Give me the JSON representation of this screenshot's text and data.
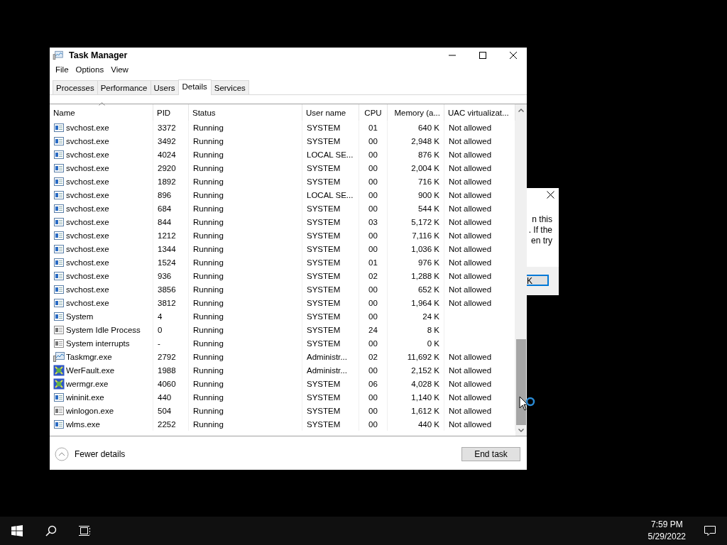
{
  "window": {
    "title": "Task Manager"
  },
  "menu": [
    "File",
    "Options",
    "View"
  ],
  "tabs": [
    {
      "label": "Processes",
      "selected": false
    },
    {
      "label": "Performance",
      "selected": false
    },
    {
      "label": "Users",
      "selected": false
    },
    {
      "label": "Details",
      "selected": true
    },
    {
      "label": "Services",
      "selected": false
    }
  ],
  "table": {
    "columns": [
      {
        "label": "Name",
        "sorted": true
      },
      {
        "label": "PID",
        "sorted": false
      },
      {
        "label": "Status",
        "sorted": false
      },
      {
        "label": "User name",
        "sorted": false
      },
      {
        "label": "CPU",
        "sorted": false
      },
      {
        "label": "Memory (a...",
        "sorted": false
      },
      {
        "label": "UAC virtualizat...",
        "sorted": false
      }
    ],
    "rows": [
      {
        "kind": "service",
        "cells": [
          "svchost.exe",
          "3372",
          "Running",
          "SYSTEM",
          "01",
          "640 K",
          "Not allowed"
        ]
      },
      {
        "kind": "service",
        "cells": [
          "svchost.exe",
          "3492",
          "Running",
          "SYSTEM",
          "00",
          "2,948 K",
          "Not allowed"
        ]
      },
      {
        "kind": "service",
        "cells": [
          "svchost.exe",
          "4024",
          "Running",
          "LOCAL SE...",
          "00",
          "876 K",
          "Not allowed"
        ]
      },
      {
        "kind": "service",
        "cells": [
          "svchost.exe",
          "2920",
          "Running",
          "SYSTEM",
          "00",
          "2,004 K",
          "Not allowed"
        ]
      },
      {
        "kind": "service",
        "cells": [
          "svchost.exe",
          "1892",
          "Running",
          "SYSTEM",
          "00",
          "716 K",
          "Not allowed"
        ]
      },
      {
        "kind": "service",
        "cells": [
          "svchost.exe",
          "896",
          "Running",
          "LOCAL SE...",
          "00",
          "900 K",
          "Not allowed"
        ]
      },
      {
        "kind": "service",
        "cells": [
          "svchost.exe",
          "684",
          "Running",
          "SYSTEM",
          "00",
          "544 K",
          "Not allowed"
        ]
      },
      {
        "kind": "service",
        "cells": [
          "svchost.exe",
          "844",
          "Running",
          "SYSTEM",
          "03",
          "5,172 K",
          "Not allowed"
        ]
      },
      {
        "kind": "service",
        "cells": [
          "svchost.exe",
          "1212",
          "Running",
          "SYSTEM",
          "00",
          "7,116 K",
          "Not allowed"
        ]
      },
      {
        "kind": "service",
        "cells": [
          "svchost.exe",
          "1344",
          "Running",
          "SYSTEM",
          "00",
          "1,036 K",
          "Not allowed"
        ]
      },
      {
        "kind": "service",
        "cells": [
          "svchost.exe",
          "1524",
          "Running",
          "SYSTEM",
          "01",
          "976 K",
          "Not allowed"
        ]
      },
      {
        "kind": "service",
        "cells": [
          "svchost.exe",
          "936",
          "Running",
          "SYSTEM",
          "02",
          "1,288 K",
          "Not allowed"
        ]
      },
      {
        "kind": "service",
        "cells": [
          "svchost.exe",
          "3856",
          "Running",
          "SYSTEM",
          "00",
          "652 K",
          "Not allowed"
        ]
      },
      {
        "kind": "service",
        "cells": [
          "svchost.exe",
          "3812",
          "Running",
          "SYSTEM",
          "00",
          "1,964 K",
          "Not allowed"
        ]
      },
      {
        "kind": "service",
        "cells": [
          "System",
          "4",
          "Running",
          "SYSTEM",
          "00",
          "24 K"
        ]
      },
      {
        "kind": "system",
        "cells": [
          "System Idle Process",
          "0",
          "Running",
          "SYSTEM",
          "24",
          "8 K"
        ]
      },
      {
        "kind": "system",
        "cells": [
          "System interrupts",
          "-",
          "Running",
          "SYSTEM",
          "00",
          "0 K"
        ]
      },
      {
        "kind": "monitor",
        "cells": [
          "Taskmgr.exe",
          "2792",
          "Running",
          "Administr...",
          "02",
          "11,692 K",
          "Not allowed"
        ]
      },
      {
        "kind": "report",
        "cells": [
          "WerFault.exe",
          "1988",
          "Running",
          "Administr...",
          "00",
          "2,152 K",
          "Not allowed"
        ]
      },
      {
        "kind": "report",
        "cells": [
          "wermgr.exe",
          "4060",
          "Running",
          "SYSTEM",
          "06",
          "4,028 K",
          "Not allowed"
        ]
      },
      {
        "kind": "service",
        "cells": [
          "wininit.exe",
          "440",
          "Running",
          "SYSTEM",
          "00",
          "1,140 K",
          "Not allowed"
        ]
      },
      {
        "kind": "system",
        "cells": [
          "winlogon.exe",
          "504",
          "Running",
          "SYSTEM",
          "00",
          "1,612 K",
          "Not allowed"
        ]
      },
      {
        "kind": "service",
        "cells": [
          "wlms.exe",
          "2252",
          "Running",
          "SYSTEM",
          "00",
          "440 K",
          "Not allowed"
        ]
      }
    ]
  },
  "footer": {
    "toggle": "Fewer details",
    "button": "End task"
  },
  "dialog": {
    "lines": [
      "n this",
      ". If the",
      "en try"
    ],
    "button": "K"
  },
  "taskbar": {
    "time": "7:59 PM",
    "date": "5/29/2022"
  }
}
